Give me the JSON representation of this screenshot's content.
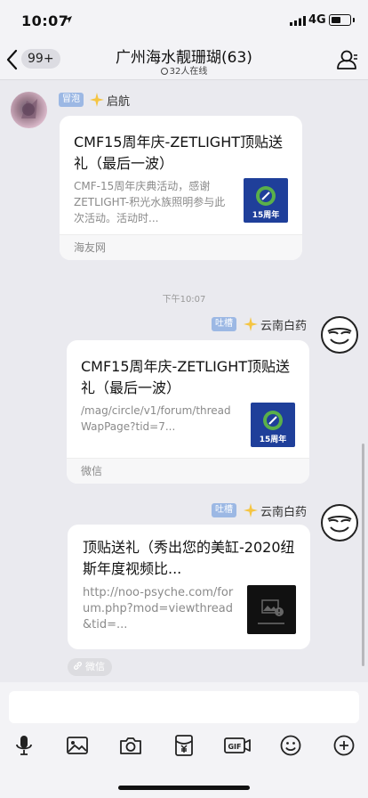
{
  "status_bar": {
    "time": "10:07",
    "network": "4G"
  },
  "nav": {
    "back_badge": "99+",
    "title": "广州海水靓珊瑚(63)",
    "online_text": "32人在线"
  },
  "messages": [
    {
      "tag": "冒泡",
      "sender": "启航",
      "card_title": "CMF15周年庆-ZETLIGHT顶贴送礼（最后一波）",
      "card_desc": "CMF-15周年庆典活动，感谢ZETLIGHT-积光水族照明参与此次活动。活动时...",
      "thumb_label": "15周年",
      "source": "海友网"
    },
    {
      "tag": "吐槽",
      "sender": "云南白药",
      "card_title": "CMF15周年庆-ZETLIGHT顶贴送礼（最后一波）",
      "card_desc": "/mag/circle/v1/forum/threadWapPage?tid=7...",
      "thumb_label": "15周年",
      "source": "微信"
    },
    {
      "tag": "吐槽",
      "sender": "云南白药",
      "card_title": "顶贴送礼（秀出您的美缸-2020纽斯年度视频比...",
      "card_desc": "http://noo-psyche.com/forum.php?mod=viewthread&tid=...",
      "thumb_label": "",
      "source": "微信"
    }
  ],
  "timestamp": "下午10:07",
  "toolbar": {
    "icons": [
      "microphone-icon",
      "image-icon",
      "camera-icon",
      "red-packet-icon",
      "gif-icon",
      "emoji-icon",
      "plus-icon"
    ],
    "gif_label": "GIF"
  },
  "colors": {
    "tag_bg": "#9cb8e4",
    "background": "#eaeaef",
    "card_bg": "#ffffff"
  }
}
